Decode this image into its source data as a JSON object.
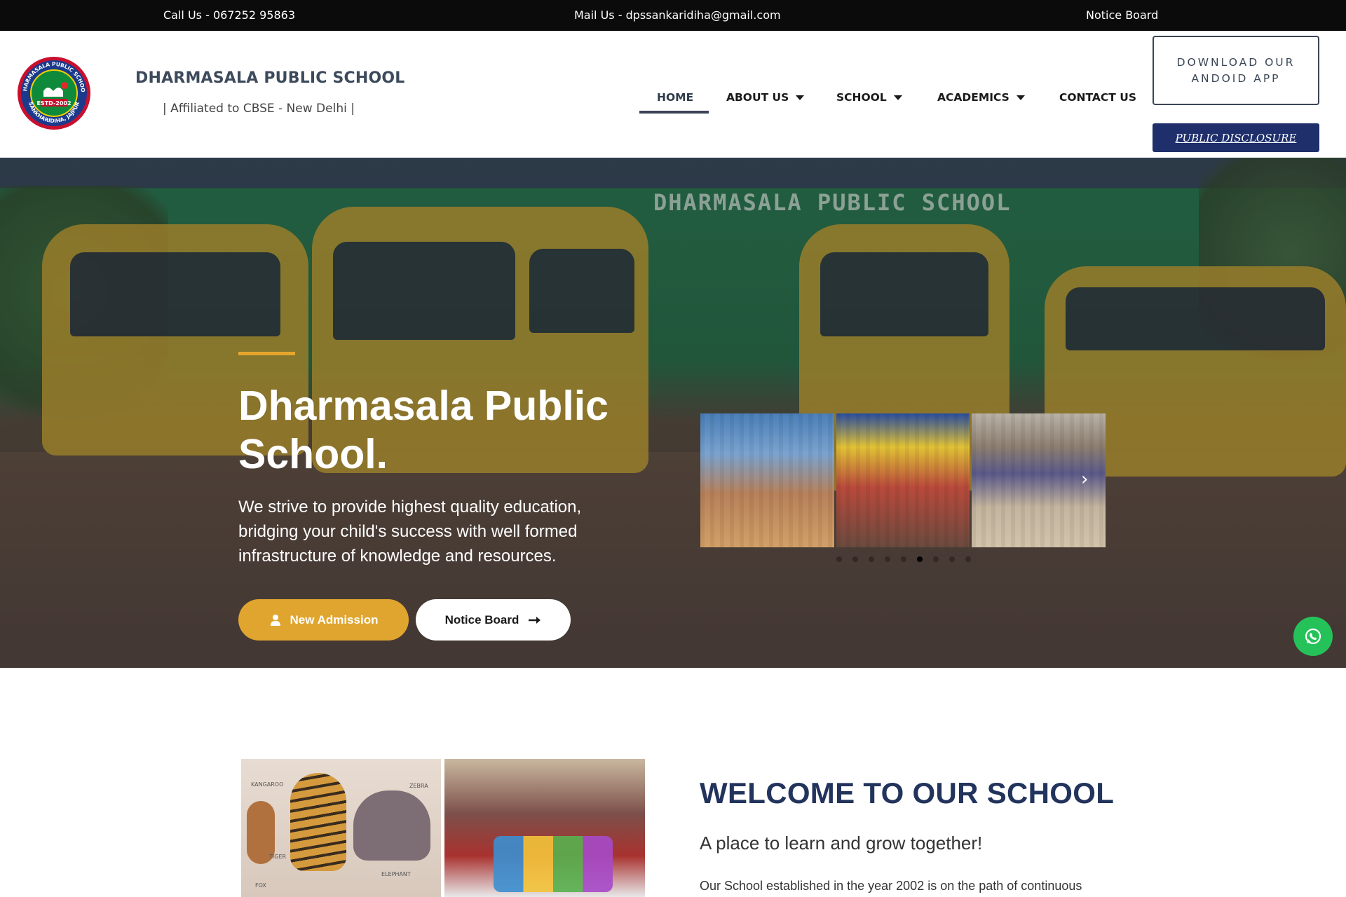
{
  "topbar": {
    "call": "Call Us - 067252 95863",
    "mail": "Mail Us - dpssankaridiha@gmail.com",
    "notice": "Notice Board"
  },
  "header": {
    "school_name": "DHARMASALA PUBLIC SCHOOL",
    "affiliation": "| Affiliated to CBSE - New Delhi |",
    "logo": {
      "icon": "school-crest-logo",
      "text_top": "DHARMASALA PUBLIC SCHOOL",
      "text_bottom": "SANKHARIDIHA, JAJPUR",
      "estd": "ESTD-2002"
    }
  },
  "nav": {
    "items": [
      {
        "label": "HOME",
        "active": true,
        "has_dropdown": false
      },
      {
        "label": "ABOUT US",
        "active": false,
        "has_dropdown": true
      },
      {
        "label": "SCHOOL",
        "active": false,
        "has_dropdown": true
      },
      {
        "label": "ACADEMICS",
        "active": false,
        "has_dropdown": true
      },
      {
        "label": "CONTACT US",
        "active": false,
        "has_dropdown": false
      }
    ],
    "download_app": "DOWNLOAD OUR ANDOID APP",
    "public_disclosure": "PUBLIC DISCLOSURE"
  },
  "hero": {
    "building_sign": "DHARMASALA PUBLIC SCHOOL",
    "title": "Dharmasala Public School.",
    "description": "We strive to provide highest quality education, bridging your child's success with well formed infrastructure of knowledge and resources.",
    "admission_button": "New Admission",
    "notice_button": "Notice Board",
    "carousel": {
      "total_dots": 9,
      "active_dot": 6
    },
    "accent_color": "#e0a52e"
  },
  "welcome": {
    "title": "WELCOME TO OUR SCHOOL",
    "subtitle": "A place to learn and grow together!",
    "body": "Our School established in the year 2002 is on the path of continuous",
    "pic_labels": [
      "KANGAROO",
      "ZEBRA",
      "TIGER",
      "ELEPHANT",
      "FOX"
    ]
  },
  "colors": {
    "topbar": "#0b0b0b",
    "primary_navy": "#22335c",
    "disclosure_button": "#1e2f6b",
    "whatsapp": "#25c25a"
  }
}
